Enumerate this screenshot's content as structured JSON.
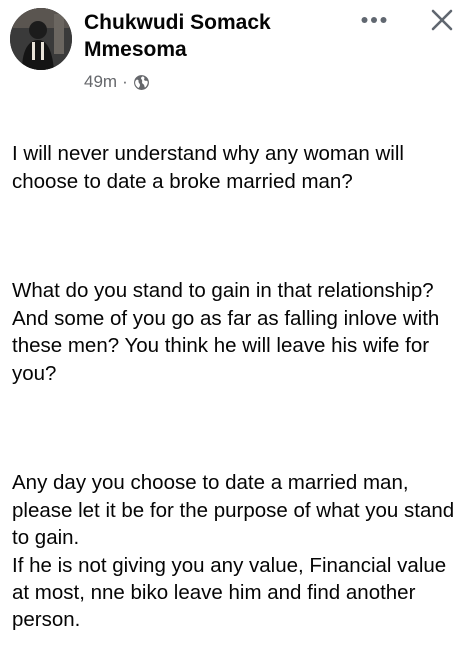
{
  "post": {
    "author": {
      "name": "Chukwudi Somack Mmesoma"
    },
    "meta": {
      "time": "49m",
      "separator": "·",
      "audience_icon": "globe-icon"
    },
    "actions": {
      "more_icon": "more-horizontal-icon",
      "close_icon": "close-icon"
    },
    "paragraphs": [
      "I will never understand why any  woman will choose to date a broke married man?",
      "What do you stand to gain in that relationship?\nAnd some of you go as far as falling inlove with these men? You think he will leave his wife for you?",
      "Any day you choose to date a married man, please let it be for the purpose of what you stand to gain.\nIf he is not giving you any value, Financial value at most, nne biko leave him and find another person."
    ]
  },
  "colors": {
    "text_primary": "#050505",
    "text_secondary": "#65676b",
    "icon_gray": "#606770"
  }
}
